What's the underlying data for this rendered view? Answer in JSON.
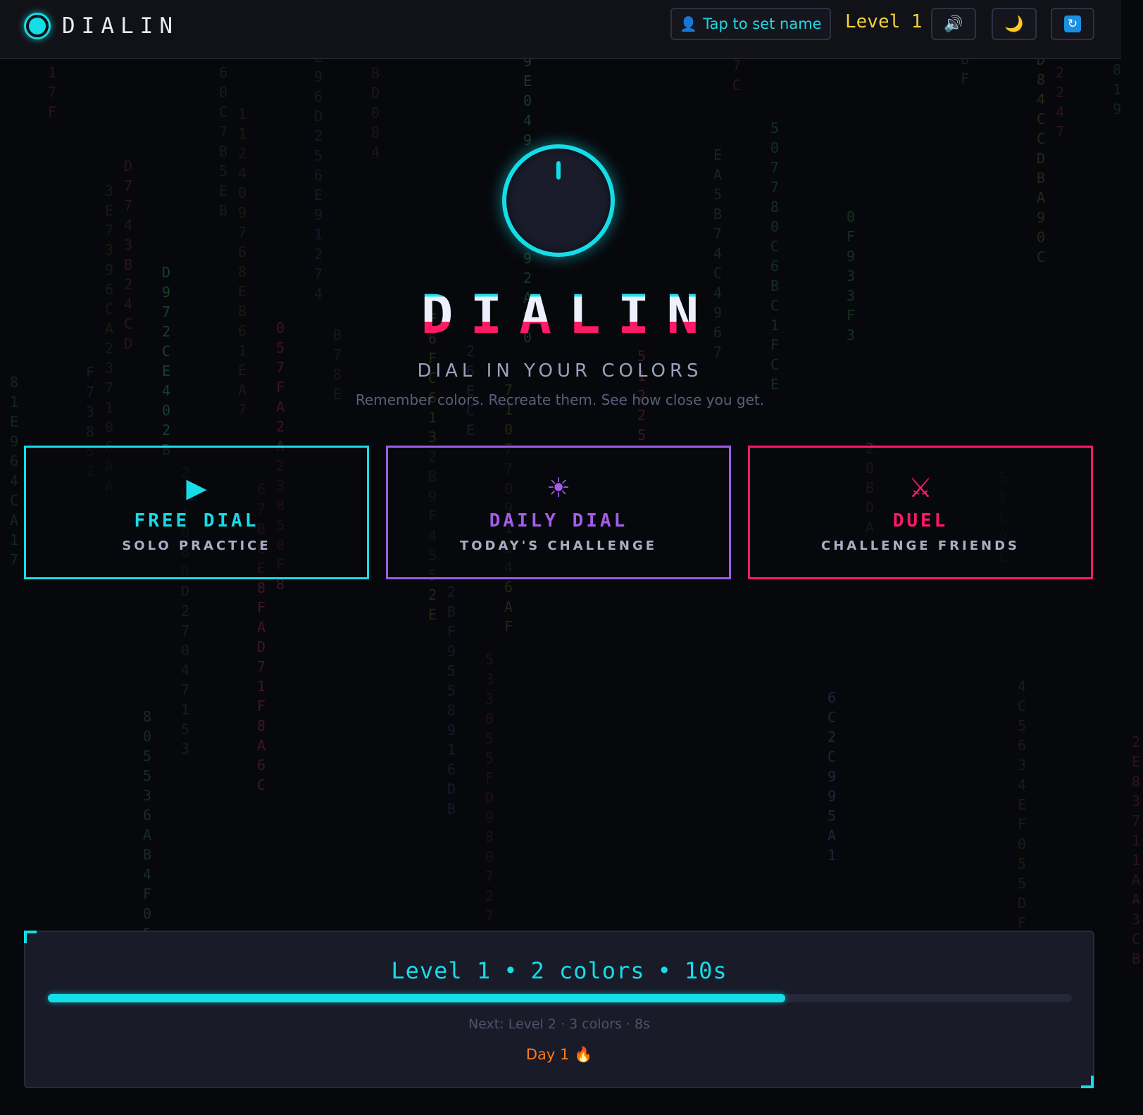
{
  "header": {
    "brand": "DIALIN",
    "name_button": "Tap to set name",
    "level_badge": "Level 1",
    "icons": {
      "logo": "dial-logo-icon",
      "user": "user-icon",
      "sound": "speaker-icon",
      "theme": "moon-icon",
      "sync": "refresh-icon"
    }
  },
  "hero": {
    "title": "DIALIN",
    "tagline": "DIAL IN YOUR COLORS",
    "subtitle": "Remember colors. Recreate them. See how close you get."
  },
  "modes": [
    {
      "title": "FREE DIAL",
      "subtitle": "SOLO PRACTICE",
      "icon": "play-icon",
      "color": "#15dde8"
    },
    {
      "title": "DAILY DIAL",
      "subtitle": "TODAY'S CHALLENGE",
      "icon": "sun-icon",
      "color": "#a35de8"
    },
    {
      "title": "DUEL",
      "subtitle": "CHALLENGE FRIENDS",
      "icon": "crossed-swords-icon",
      "color": "#ff1a66"
    }
  ],
  "progress": {
    "level": "Level 1",
    "colors": "2 colors",
    "time": "10s",
    "separator": "•",
    "fraction": 0.72,
    "next": "Next: Level 2 · 3 colors · 8s",
    "streak": "Day 1",
    "streak_icon": "flame-icon"
  },
  "theme": {
    "accent": "#15dde8",
    "purple": "#a35de8",
    "pink": "#ff1a66",
    "gold": "#f2d23a",
    "background": "#07080c"
  }
}
